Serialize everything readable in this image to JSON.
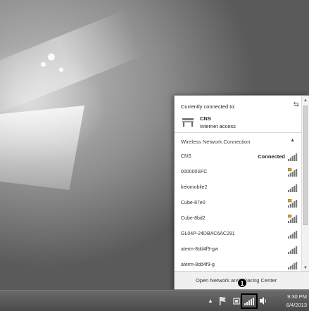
{
  "flyout": {
    "header": "Currently connected to:",
    "connection_name": "CNS",
    "connection_status": "Internet access",
    "group_label": "Wireless Network Connection",
    "networks": [
      {
        "name": "CNS",
        "status": "Connected",
        "secured": false
      },
      {
        "name": "000000SFC",
        "status": "",
        "secured": true
      },
      {
        "name": "keiomobile2",
        "status": "",
        "secured": false
      },
      {
        "name": "Cube-87e0",
        "status": "",
        "secured": true
      },
      {
        "name": "Cube-8bd2",
        "status": "",
        "secured": true
      },
      {
        "name": "GL04P-24DBAC6AC291",
        "status": "",
        "secured": false
      },
      {
        "name": "aterm-8dd4f9-gw",
        "status": "",
        "secured": false
      },
      {
        "name": "aterm-8dd4f9-g",
        "status": "",
        "secured": false
      }
    ],
    "footer_link": "Open Network and Sharing Center"
  },
  "taskbar": {
    "time": "9:30 PM",
    "date": "6/4/2013"
  },
  "callout_number": "1",
  "colors": {
    "taskbar": "#4a4a4a",
    "flyout_bg": "#ffffff",
    "highlight_box": "#000000"
  },
  "icons": {
    "refresh": "refresh-icon",
    "network": "network-bench-icon",
    "signal": "wifi-signal-icon",
    "chevron": "chevron-up-icon"
  }
}
